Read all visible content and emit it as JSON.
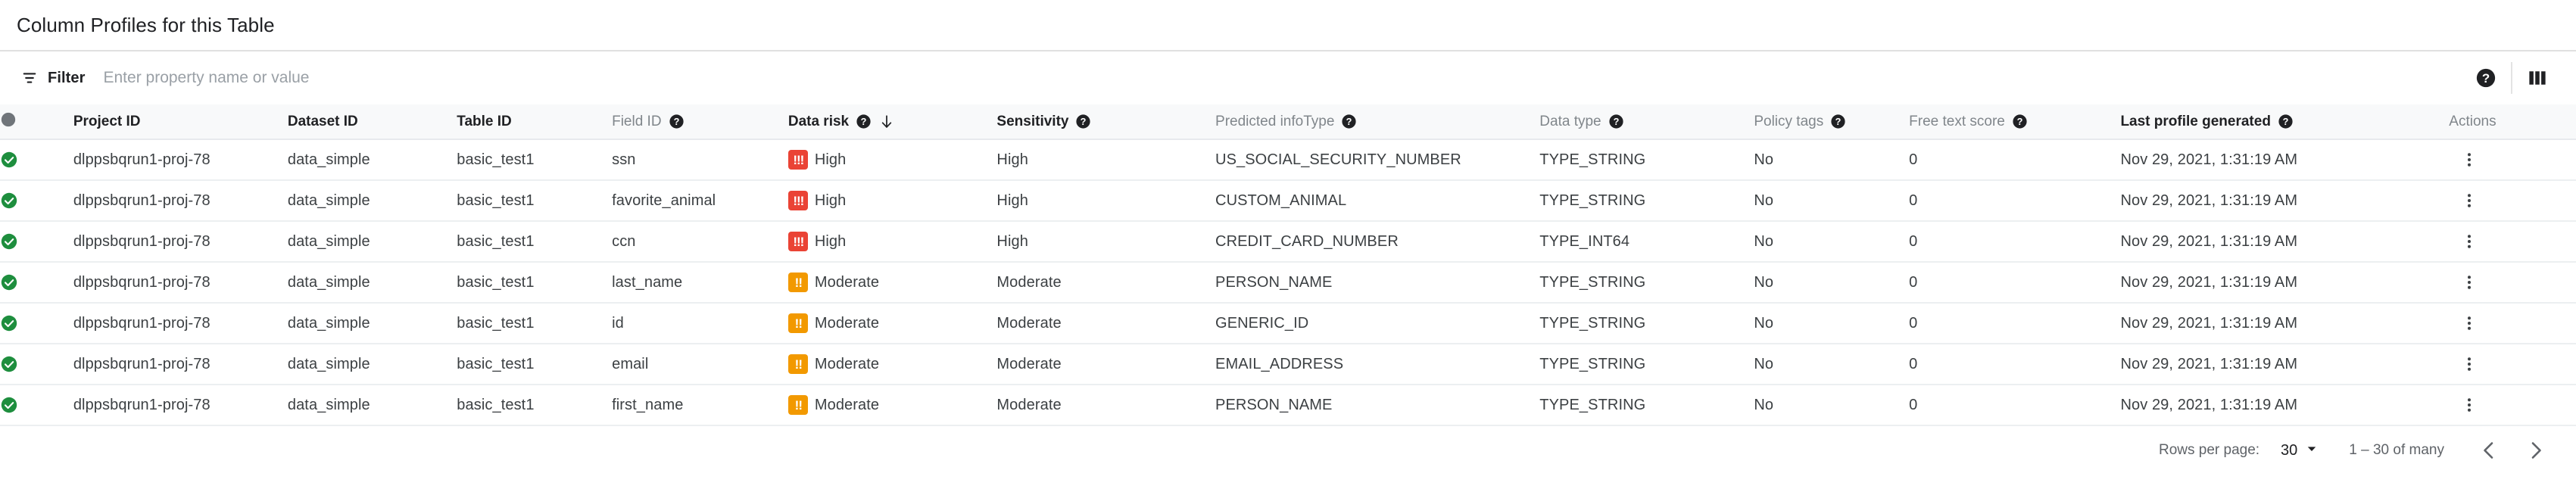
{
  "page_title": "Column Profiles for this Table",
  "toolbar": {
    "filter_label": "Filter",
    "filter_placeholder": "Enter property name or value",
    "filter_value": ""
  },
  "table": {
    "columns": [
      {
        "key": "status",
        "label": "",
        "help": false,
        "emphasis": false,
        "sorted": false
      },
      {
        "key": "project",
        "label": "Project ID",
        "help": false,
        "emphasis": true,
        "sorted": false
      },
      {
        "key": "dataset",
        "label": "Dataset ID",
        "help": false,
        "emphasis": true,
        "sorted": false
      },
      {
        "key": "table",
        "label": "Table ID",
        "help": false,
        "emphasis": true,
        "sorted": false
      },
      {
        "key": "field",
        "label": "Field ID",
        "help": true,
        "emphasis": false,
        "sorted": false
      },
      {
        "key": "risk",
        "label": "Data risk",
        "help": true,
        "emphasis": true,
        "sorted": true
      },
      {
        "key": "sens",
        "label": "Sensitivity",
        "help": true,
        "emphasis": true,
        "sorted": false
      },
      {
        "key": "info",
        "label": "Predicted infoType",
        "help": true,
        "emphasis": false,
        "sorted": false
      },
      {
        "key": "dtype",
        "label": "Data type",
        "help": true,
        "emphasis": false,
        "sorted": false
      },
      {
        "key": "policy",
        "label": "Policy tags",
        "help": true,
        "emphasis": false,
        "sorted": false
      },
      {
        "key": "free",
        "label": "Free text score",
        "help": true,
        "emphasis": false,
        "sorted": false
      },
      {
        "key": "last",
        "label": "Last profile generated",
        "help": true,
        "emphasis": true,
        "sorted": false
      },
      {
        "key": "actions",
        "label": "Actions",
        "help": false,
        "emphasis": false,
        "sorted": false
      }
    ],
    "sort_direction": "descending",
    "rows": [
      {
        "status": "ok",
        "project": "dlppsbqrun1-proj-78",
        "dataset": "data_simple",
        "table": "basic_test1",
        "field": "ssn",
        "risk": "High",
        "risk_level": "high",
        "sensitivity": "High",
        "info_type": "US_SOCIAL_SECURITY_NUMBER",
        "data_type": "TYPE_STRING",
        "policy_tags": "No",
        "free_text_score": "0",
        "last_profile": "Nov 29, 2021, 1:31:19 AM"
      },
      {
        "status": "ok",
        "project": "dlppsbqrun1-proj-78",
        "dataset": "data_simple",
        "table": "basic_test1",
        "field": "favorite_animal",
        "risk": "High",
        "risk_level": "high",
        "sensitivity": "High",
        "info_type": "CUSTOM_ANIMAL",
        "data_type": "TYPE_STRING",
        "policy_tags": "No",
        "free_text_score": "0",
        "last_profile": "Nov 29, 2021, 1:31:19 AM"
      },
      {
        "status": "ok",
        "project": "dlppsbqrun1-proj-78",
        "dataset": "data_simple",
        "table": "basic_test1",
        "field": "ccn",
        "risk": "High",
        "risk_level": "high",
        "sensitivity": "High",
        "info_type": "CREDIT_CARD_NUMBER",
        "data_type": "TYPE_INT64",
        "policy_tags": "No",
        "free_text_score": "0",
        "last_profile": "Nov 29, 2021, 1:31:19 AM"
      },
      {
        "status": "ok",
        "project": "dlppsbqrun1-proj-78",
        "dataset": "data_simple",
        "table": "basic_test1",
        "field": "last_name",
        "risk": "Moderate",
        "risk_level": "moderate",
        "sensitivity": "Moderate",
        "info_type": "PERSON_NAME",
        "data_type": "TYPE_STRING",
        "policy_tags": "No",
        "free_text_score": "0",
        "last_profile": "Nov 29, 2021, 1:31:19 AM"
      },
      {
        "status": "ok",
        "project": "dlppsbqrun1-proj-78",
        "dataset": "data_simple",
        "table": "basic_test1",
        "field": "id",
        "risk": "Moderate",
        "risk_level": "moderate",
        "sensitivity": "Moderate",
        "info_type": "GENERIC_ID",
        "data_type": "TYPE_STRING",
        "policy_tags": "No",
        "free_text_score": "0",
        "last_profile": "Nov 29, 2021, 1:31:19 AM"
      },
      {
        "status": "ok",
        "project": "dlppsbqrun1-proj-78",
        "dataset": "data_simple",
        "table": "basic_test1",
        "field": "email",
        "risk": "Moderate",
        "risk_level": "moderate",
        "sensitivity": "Moderate",
        "info_type": "EMAIL_ADDRESS",
        "data_type": "TYPE_STRING",
        "policy_tags": "No",
        "free_text_score": "0",
        "last_profile": "Nov 29, 2021, 1:31:19 AM"
      },
      {
        "status": "ok",
        "project": "dlppsbqrun1-proj-78",
        "dataset": "data_simple",
        "table": "basic_test1",
        "field": "first_name",
        "risk": "Moderate",
        "risk_level": "moderate",
        "sensitivity": "Moderate",
        "info_type": "PERSON_NAME",
        "data_type": "TYPE_STRING",
        "policy_tags": "No",
        "free_text_score": "0",
        "last_profile": "Nov 29, 2021, 1:31:19 AM"
      }
    ]
  },
  "paginator": {
    "rows_per_page_label": "Rows per page:",
    "rows_per_page_value": "30",
    "range_label": "1 – 30 of many"
  },
  "risk_badge_text": {
    "high": "!!!",
    "moderate": "!!"
  },
  "colors": {
    "high": "#ea4335",
    "moderate": "#f29900",
    "status_ok": "#1e8e3e",
    "header_bg": "#f8f9fa",
    "text_primary": "#202124",
    "text_secondary": "#5f6368",
    "text_muted": "#80868b"
  },
  "icons": {
    "filter": "filter-icon",
    "help": "help-icon",
    "columns": "columns-icon",
    "sort_desc": "arrow-down-icon",
    "status_ok": "check-circle-icon",
    "more": "more-vert-icon",
    "prev": "chevron-left-icon",
    "next": "chevron-right-icon",
    "dropdown": "chevron-down-icon"
  }
}
